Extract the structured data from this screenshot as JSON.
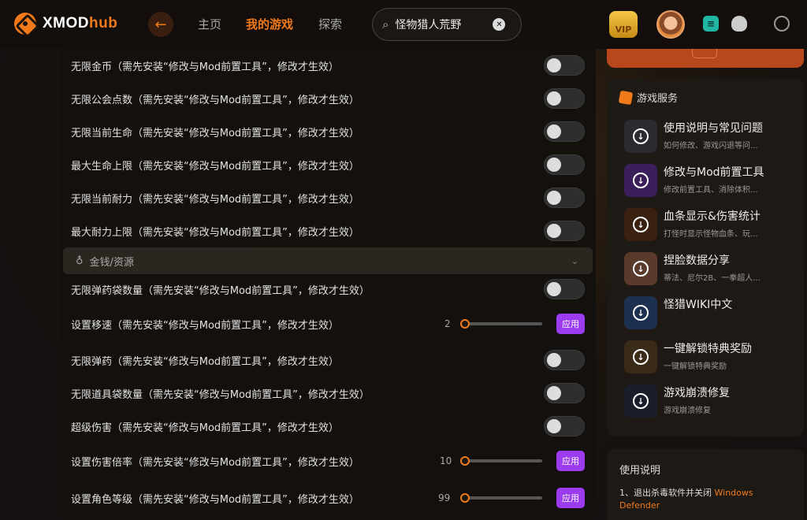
{
  "app": {
    "logo_main": "XMOD",
    "logo_accent": "hub"
  },
  "header": {
    "nav": [
      "主页",
      "我的游戏",
      "探索"
    ],
    "search_value": "怪物猎人荒野",
    "vip_label": "VIP"
  },
  "cheats": {
    "rows_top": [
      "无限金币（需先安装“修改与Mod前置工具”，修改才生效）",
      "无限公会点数（需先安装“修改与Mod前置工具”，修改才生效）",
      "无限当前生命（需先安装“修改与Mod前置工具”，修改才生效）",
      "最大生命上限（需先安装“修改与Mod前置工具”，修改才生效）",
      "无限当前耐力（需先安装“修改与Mod前置工具”，修改才生效）",
      "最大耐力上限（需先安装“修改与Mod前置工具”，修改才生效）"
    ],
    "section_title": "金钱/资源",
    "rows_bottom": [
      {
        "label": "无限弹药袋数量（需先安装“修改与Mod前置工具”，修改才生效）",
        "type": "toggle"
      },
      {
        "label": "设置移速（需先安装“修改与Mod前置工具”，修改才生效）",
        "type": "slider",
        "value": "2",
        "fraction": 0.05
      },
      {
        "label": "无限弹药（需先安装“修改与Mod前置工具”，修改才生效）",
        "type": "toggle"
      },
      {
        "label": "无限道具袋数量（需先安装“修改与Mod前置工具”，修改才生效）",
        "type": "toggle"
      },
      {
        "label": "超级伤害（需先安装“修改与Mod前置工具”，修改才生效）",
        "type": "toggle"
      },
      {
        "label": "设置伤害倍率（需先安装“修改与Mod前置工具”，修改才生效）",
        "type": "slider",
        "value": "10",
        "fraction": 0.05
      },
      {
        "label": "设置角色等级（需先安装“修改与Mod前置工具”，修改才生效）",
        "type": "slider",
        "value": "99",
        "fraction": 0.0
      }
    ],
    "apply_label": "应用"
  },
  "services": {
    "title": "游戏服务",
    "items": [
      {
        "name": "使用说明与常见问题",
        "desc": "如何修改、游戏闪退等问...",
        "color": "#2a2a30"
      },
      {
        "name": "修改与Mod前置工具",
        "desc": "修改前置工具、消除体积...",
        "color": "#3a1f5a"
      },
      {
        "name": "血条显示&伤害统计",
        "desc": "打怪时显示怪物血条、玩...",
        "color": "#3a2010"
      },
      {
        "name": "捏脸数据分享",
        "desc": "蒂法、尼尔2B、一拳超人...",
        "color": "#5a3a2a"
      },
      {
        "name": "怪猎WIKI中文",
        "desc": "",
        "color": "#1e3050"
      },
      {
        "name": "一键解锁特典奖励",
        "desc": "一键解锁特典奖励",
        "color": "#3a2a18"
      },
      {
        "name": "游戏崩溃修复",
        "desc": "游戏崩溃修复",
        "color": "#1a1e2a"
      }
    ]
  },
  "instructions": {
    "title": "使用说明",
    "line_prefix": "1、退出杀毒软件并关闭 ",
    "line_highlight": "Windows Defender"
  }
}
